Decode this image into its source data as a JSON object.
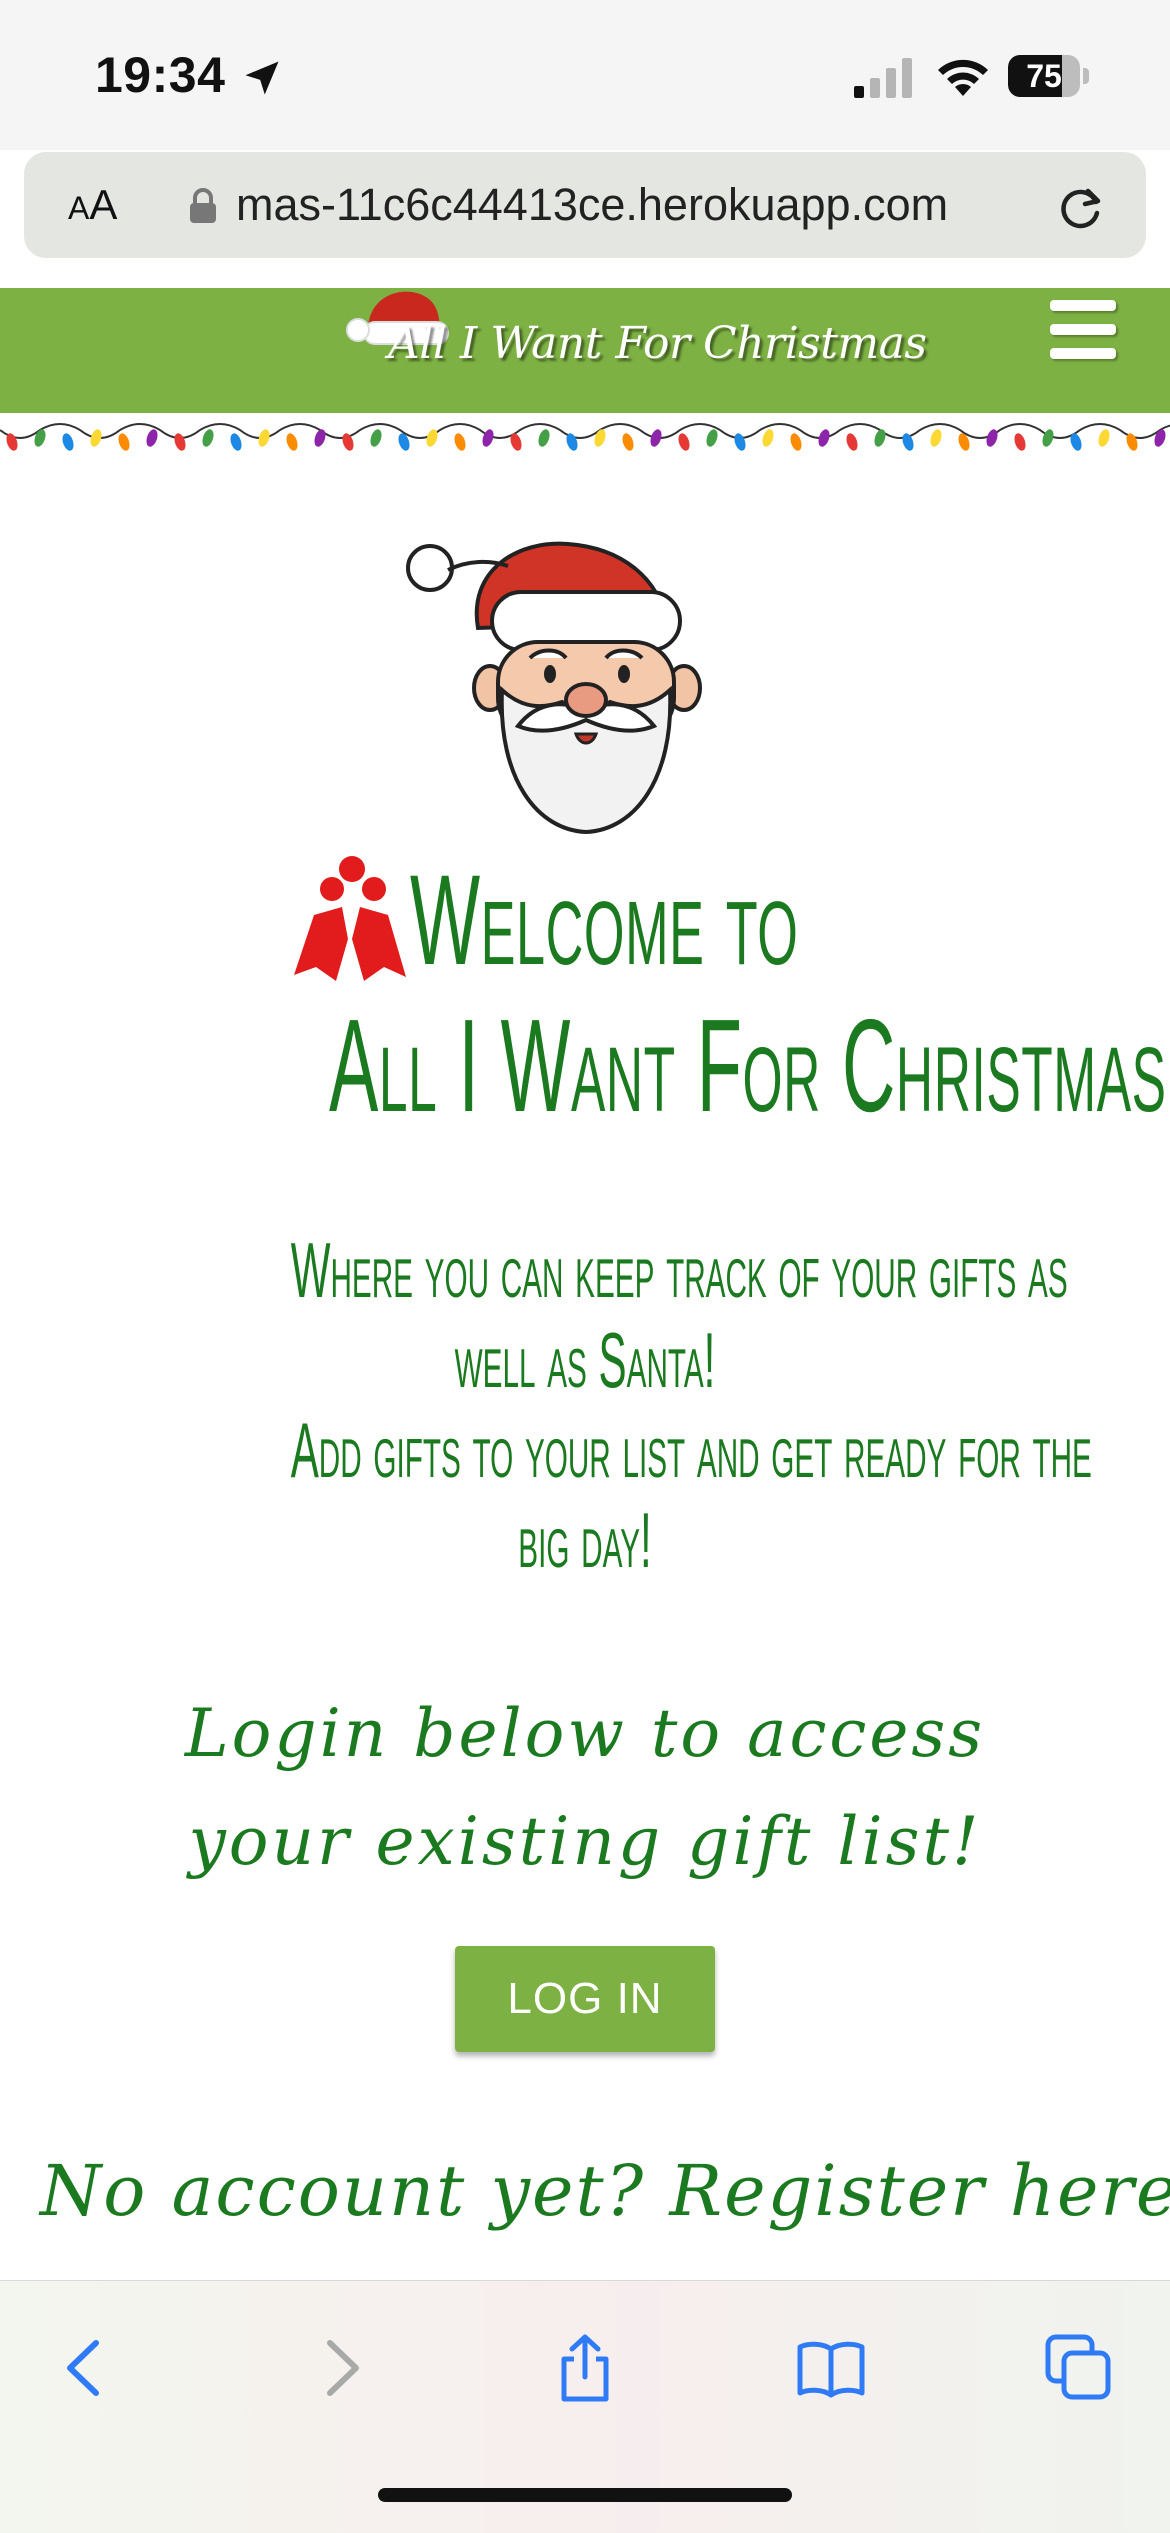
{
  "status_bar": {
    "time": "19:34",
    "battery_level": "75",
    "battery_fraction": 0.75
  },
  "browser": {
    "text_size_label_small": "A",
    "text_size_label_large": "A",
    "url": "mas-11c6c44413ce.herokuapp.com"
  },
  "site": {
    "logo_text": "All I Want For Christmas",
    "heading_line1": "Welcome to",
    "heading_line2": "All I Want For Christmas",
    "tagline": [
      "Where you can keep track of your gifts as",
      "well as Santa!",
      "Add gifts to your list and get ready for the",
      "big day!"
    ],
    "login_prompt": "Login below to access your existing gift list!",
    "login_button": "LOG IN",
    "register_prompt": "No account yet? Register here!"
  },
  "colors": {
    "brand_green": "#7db143",
    "text_green": "#1b7a1f",
    "ios_blue": "#2f7bf5"
  },
  "icons": {
    "location": "location-arrow-icon",
    "signal": "cellular-signal-icon",
    "wifi": "wifi-icon",
    "lock": "lock-icon",
    "reload": "reload-icon",
    "menu": "hamburger-menu-icon",
    "back": "back-chevron-icon",
    "forward": "forward-chevron-icon",
    "share": "share-icon",
    "bookmarks": "bookmarks-icon",
    "tabs": "tabs-icon"
  }
}
